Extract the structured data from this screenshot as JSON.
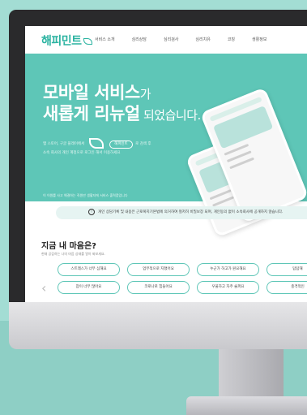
{
  "header": {
    "logo": "해피민트",
    "nav": [
      "서비스 소개",
      "심리상담",
      "심리검사",
      "심리치유",
      "코칭",
      "생활정보"
    ]
  },
  "hero": {
    "title_line1": "모바일 서비스",
    "title_line1_suffix": "가",
    "title_line2": "새롭게 리뉴얼",
    "title_line2_suffix": " 되었습니다.",
    "desc_line1_prefix": "앱 스토어, 구글 플레이에서",
    "desc_pill": "해피민트",
    "desc_line1_suffix": "로 검색 후",
    "desc_line2": "소속 회사의 개인 계정으로 로그인 해서 이용하세요",
    "note": "이 이원를 사고 해결하는 직원만 생활지에 서비스 출력품입니다"
  },
  "notice": {
    "text": "개인 상담기록 및 내용은 근로복지기본법에 의거하여 철저히 비밀보장 되며, 개인동의 없이 소속회사에 공개하지 않습니다."
  },
  "mood": {
    "title": "지금 내 마음은?",
    "subtitle": "현재 공감하는 나의 마음 상태를 알아 봐보세요.",
    "chips_row1": [
      "스트레스가 너무 심해요",
      "업무적으로 지쳤어요",
      "누군가 하고가 원요해요",
      "답답해"
    ],
    "chips_row2": [
      "잠이 너무 많아요",
      "코로나로 힘들어요",
      "우울하고 자주 슬퍼요",
      "충격적인"
    ]
  }
}
